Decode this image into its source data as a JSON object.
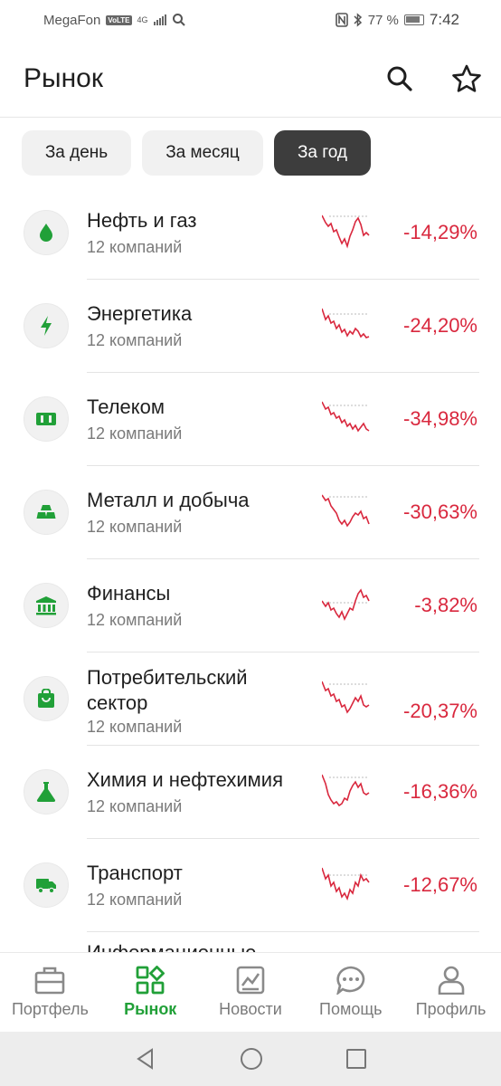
{
  "status": {
    "carrier": "MegaFon",
    "volte": "VoLTE",
    "net": "4G",
    "battery": "77 %",
    "time": "7:42"
  },
  "header": {
    "title": "Рынок"
  },
  "periods": [
    "За день",
    "За месяц",
    "За год"
  ],
  "active_period": "За год",
  "sectors": [
    {
      "name": "Нефть и газ",
      "sub": "12 компаний",
      "change": "-14,29%",
      "icon": "drop-icon"
    },
    {
      "name": "Энергетика",
      "sub": "12 компаний",
      "change": "-24,20%",
      "icon": "lightning-icon"
    },
    {
      "name": "Телеком",
      "sub": "12 компаний",
      "change": "-34,98%",
      "icon": "telecom-icon"
    },
    {
      "name": "Металл и добыча",
      "sub": "12 компаний",
      "change": "-30,63%",
      "icon": "ingots-icon"
    },
    {
      "name": "Финансы",
      "sub": "12 компаний",
      "change": "-3,82%",
      "icon": "bank-icon"
    },
    {
      "name": "Потребительский сектор",
      "sub": "12 компаний",
      "change": "-20,37%",
      "icon": "shopping-bag-icon"
    },
    {
      "name": "Химия и нефтехимия",
      "sub": "12 компаний",
      "change": "-16,36%",
      "icon": "flask-icon"
    },
    {
      "name": "Транспорт",
      "sub": "12 компаний",
      "change": "-12,67%",
      "icon": "truck-icon"
    }
  ],
  "partial_row": {
    "name": "Информационные"
  },
  "nav": [
    {
      "label": "Портфель",
      "icon": "briefcase-icon"
    },
    {
      "label": "Рынок",
      "icon": "market-icon"
    },
    {
      "label": "Новости",
      "icon": "news-icon"
    },
    {
      "label": "Помощь",
      "icon": "chat-icon"
    },
    {
      "label": "Профиль",
      "icon": "profile-icon"
    }
  ],
  "colors": {
    "accent": "#21a038",
    "negative": "#d9283e",
    "active_period_bg": "#3d3d3d"
  }
}
